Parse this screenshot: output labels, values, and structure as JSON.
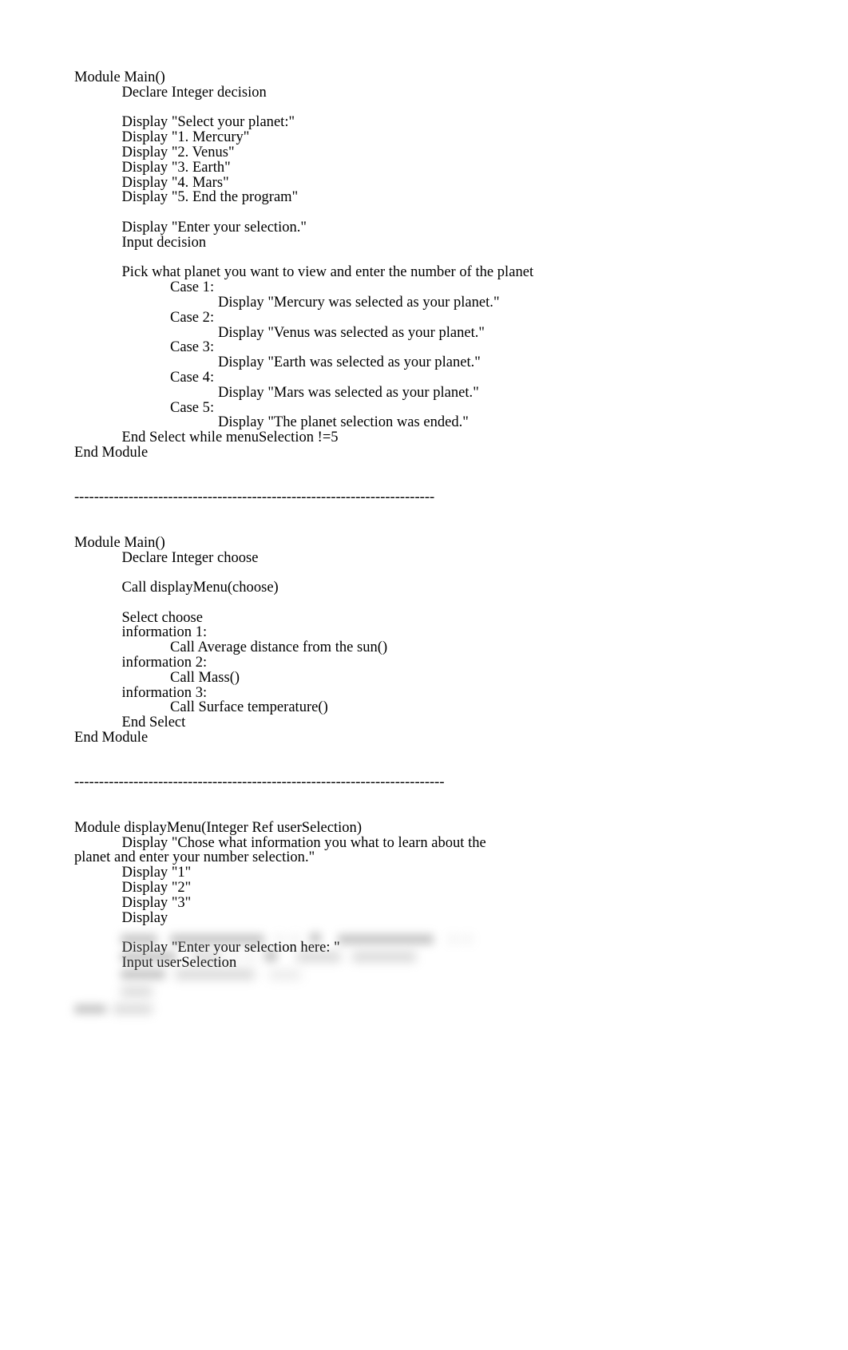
{
  "document": {
    "background_color": "#ffffff",
    "text_color": "#000000",
    "sections": [
      {
        "id": "section-1",
        "lines": [
          {
            "indent": 0,
            "text": "Module Main()"
          },
          {
            "indent": 1,
            "text": "Declare Integer decision"
          },
          {
            "indent": 0,
            "text": ""
          },
          {
            "indent": 1,
            "text": "Display \"Select your planet:\""
          },
          {
            "indent": 1,
            "text": "Display \"1. Mercury\""
          },
          {
            "indent": 1,
            "text": "Display \"2. Venus\""
          },
          {
            "indent": 1,
            "text": "Display \"3. Earth\""
          },
          {
            "indent": 1,
            "text": "Display \"4. Mars\""
          },
          {
            "indent": 1,
            "text": "Display \"5. End the program\""
          },
          {
            "indent": 0,
            "text": ""
          },
          {
            "indent": 1,
            "text": "Display \"Enter your selection.\""
          },
          {
            "indent": 1,
            "text": "Input decision"
          },
          {
            "indent": 0,
            "text": ""
          },
          {
            "indent": 1,
            "text": "Pick what planet you want to view and enter the number of the planet"
          },
          {
            "indent": 2,
            "text": "Case 1:"
          },
          {
            "indent": 3,
            "text": "Display \"Mercury was selected as your planet.\""
          },
          {
            "indent": 2,
            "text": "Case 2:"
          },
          {
            "indent": 3,
            "text": "Display \"Venus was selected as your planet.\""
          },
          {
            "indent": 2,
            "text": "Case 3:"
          },
          {
            "indent": 3,
            "text": "Display \"Earth was selected as your planet.\""
          },
          {
            "indent": 2,
            "text": "Case 4:"
          },
          {
            "indent": 3,
            "text": "Display \"Mars was selected as your planet.\""
          },
          {
            "indent": 2,
            "text": "Case 5:"
          },
          {
            "indent": 3,
            "text": "Display \"The planet selection was ended.\""
          },
          {
            "indent": 1,
            "text": "End Select while menuSelection !=5"
          },
          {
            "indent": 0,
            "text": "End Module"
          }
        ]
      }
    ],
    "divider_1": "-------------------------------------------------------------------------",
    "divider_2": "---------------------------------------------------------------------------",
    "section_2": {
      "id": "section-2",
      "lines": [
        {
          "indent": 0,
          "text": "Module Main()"
        },
        {
          "indent": 1,
          "text": "Declare Integer choose"
        },
        {
          "indent": 0,
          "text": ""
        },
        {
          "indent": 1,
          "text": "Call displayMenu(choose)"
        },
        {
          "indent": 0,
          "text": ""
        },
        {
          "indent": 1,
          "text": "Select choose"
        },
        {
          "indent": 1,
          "text": "information 1:"
        },
        {
          "indent": 2,
          "text": "Call Average distance from the sun()"
        },
        {
          "indent": 1,
          "text": "information 2:"
        },
        {
          "indent": 2,
          "text": "Call Mass()"
        },
        {
          "indent": 1,
          "text": "information 3:"
        },
        {
          "indent": 2,
          "text": "Call Surface temperature()"
        },
        {
          "indent": 1,
          "text": "End Select"
        },
        {
          "indent": 0,
          "text": "End Module"
        }
      ]
    },
    "section_3": {
      "id": "section-3",
      "heading": "Module displayMenu(Integer Ref userSelection)",
      "wrapped_line": "Display \"Chose what information you what to learn about the planet and enter your number selection.\"",
      "lines": [
        {
          "indent": 1,
          "text": "Display \"1\""
        },
        {
          "indent": 1,
          "text": "Display \"2\""
        },
        {
          "indent": 1,
          "text": "Display \"3\""
        },
        {
          "indent": 1,
          "text": "Display"
        },
        {
          "indent": 0,
          "text": ""
        },
        {
          "indent": 1,
          "text": "Display \"Enter your selection here: \""
        },
        {
          "indent": 1,
          "text": "Input userSelection"
        }
      ]
    },
    "redacted_block": {
      "description": "blurred-illegible-text-block",
      "visible_text": ""
    }
  }
}
